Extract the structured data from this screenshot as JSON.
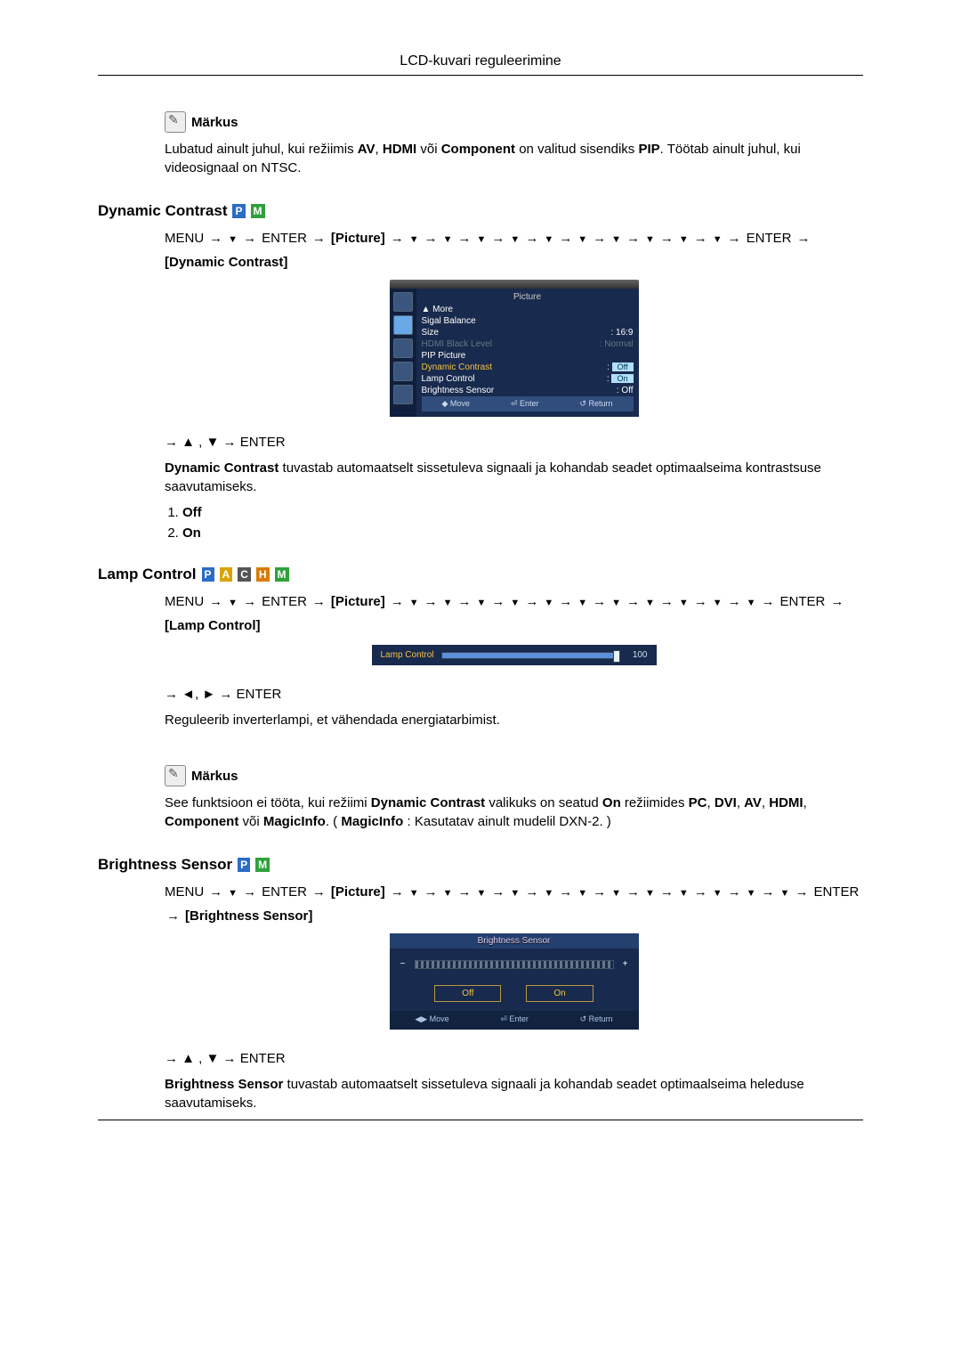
{
  "page_title": "LCD-kuvari reguleerimine",
  "note_label": "Märkus",
  "intro_paragraph": {
    "pre": "Lubatud ainult juhul, kui režiimis ",
    "b1": "AV",
    "mid1": ", ",
    "b2": "HDMI",
    "mid2": " või ",
    "b3": "Component",
    "mid3": " on valitud sisendiks ",
    "b4": "PIP",
    "post": ". Töötab ainult juhul, kui videosignaal on NTSC."
  },
  "sections": {
    "dynamic_contrast": {
      "title": "Dynamic Contrast",
      "modes": [
        "P",
        "M"
      ],
      "picture_label": "[Picture]",
      "bracket": "[Dynamic Contrast]",
      "nav_after": "→ ▲ , ▼ → ENTER",
      "desc_bold": "Dynamic Contrast",
      "desc_rest": " tuvastab automaatselt sissetuleva signaali ja kohandab seadet optimaalseima kontrastsuse saavutamiseks.",
      "opts": [
        "Off",
        "On"
      ]
    },
    "lamp_control": {
      "title": "Lamp Control",
      "modes": [
        "P",
        "A",
        "C",
        "H",
        "M"
      ],
      "picture_label": "[Picture]",
      "bracket": "[Lamp Control]",
      "nav_after": "→ ◄, ► → ENTER",
      "desc": "Reguleerib inverterlampi, et vähendada energiatarbimist.",
      "note_text": {
        "pre": "See funktsioon ei tööta, kui režiimi ",
        "b1": "Dynamic Contrast",
        "mid1": " valikuks on seatud ",
        "b2": "On",
        "mid2": " režiimides ",
        "b3": "PC",
        "mid3": ", ",
        "b4": "DVI",
        "mid4": ", ",
        "b5": "AV",
        "mid5": ", ",
        "b6": "HDMI",
        "mid6": ", ",
        "b7": "Component",
        "mid7": " või ",
        "b8": "MagicInfo",
        "mid8": ". ( ",
        "b9": "MagicInfo",
        "post": " : Kasutatav ainult mudelil DXN-2. )"
      }
    },
    "brightness_sensor": {
      "title": "Brightness Sensor",
      "modes": [
        "P",
        "M"
      ],
      "picture_label": "[Picture]",
      "bracket": "[Brightness Sensor]",
      "nav_after": "→ ▲ , ▼ → ENTER",
      "desc_bold": "Brightness Sensor",
      "desc_rest": " tuvastab automaatselt sissetuleva signaali ja kohandab seadet optimaalseima heleduse saavutamiseks."
    }
  },
  "menu_word": "MENU",
  "enter_word": "ENTER",
  "osd_picture": {
    "title": "Picture",
    "rows": {
      "more": "▲ More",
      "sigal_balance": "Sigal Balance",
      "size_k": "Size",
      "size_v": "16:9",
      "hdmi_k": "HDMI Black Level",
      "hdmi_v": "Normal",
      "pip": "PIP Picture",
      "dc_k": "Dynamic Contrast",
      "dc_v": "Off",
      "lamp_k": "Lamp Control",
      "lamp_v": "On",
      "bs_k": "Brightness Sensor",
      "bs_v": "Off"
    },
    "footer": {
      "move": "Move",
      "enter": "Enter",
      "return": "Return"
    }
  },
  "osd_lamp": {
    "label": "Lamp Control",
    "value": "100"
  },
  "osd_brsensor": {
    "title": "Brightness Sensor",
    "off": "Off",
    "on": "On",
    "footer": {
      "move": "Move",
      "enter": "Enter",
      "return": "Return"
    }
  }
}
